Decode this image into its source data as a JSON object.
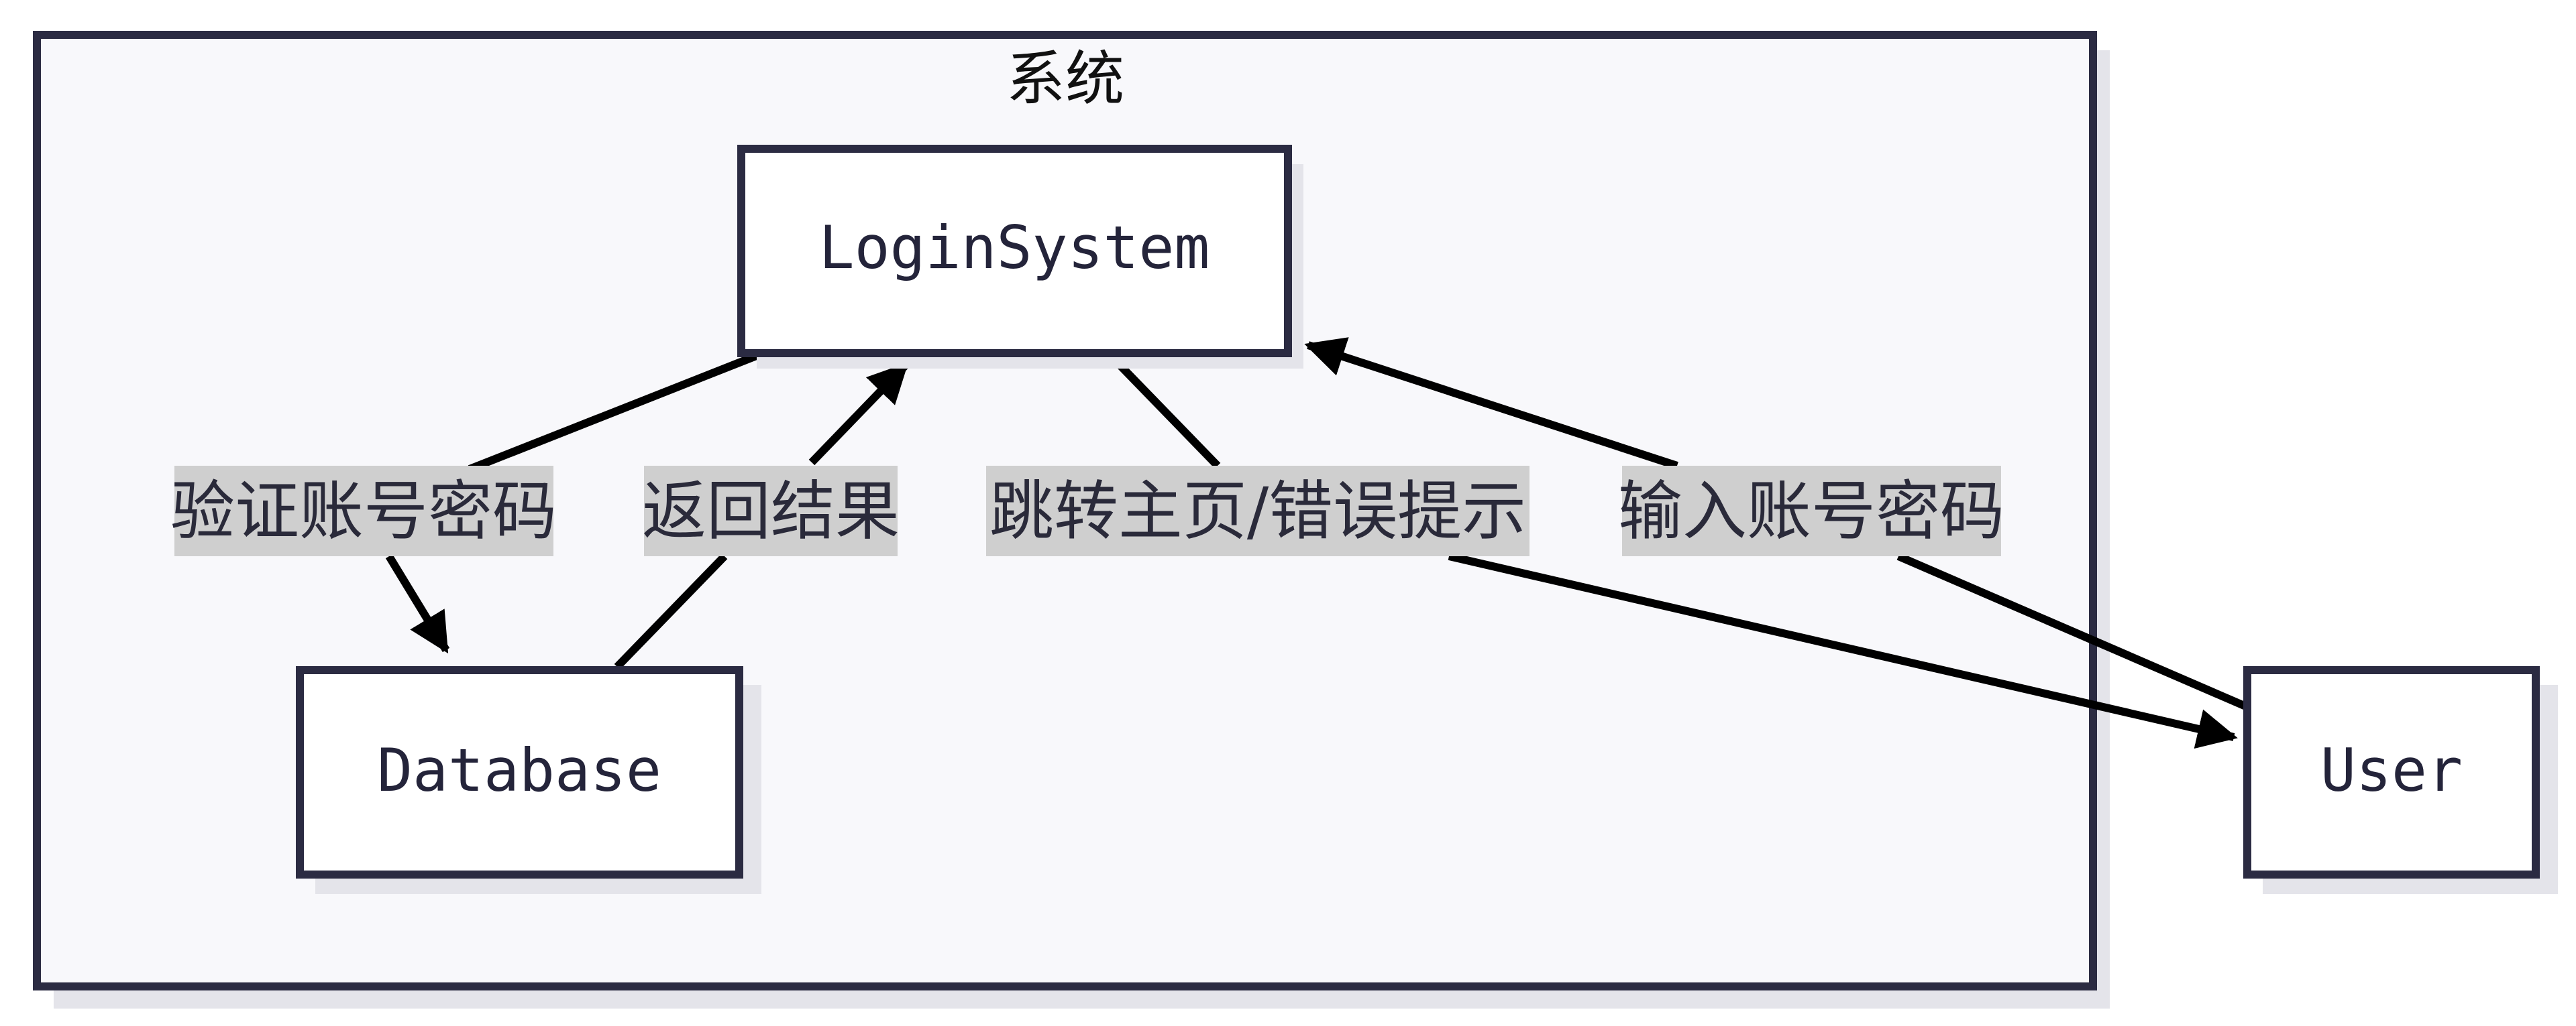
{
  "cluster": {
    "title": "系统"
  },
  "nodes": {
    "login_system": "LoginSystem",
    "database": "Database",
    "user": "User"
  },
  "edges": {
    "verify_credentials": "验证账号密码",
    "return_result": "返回结果",
    "redirect_or_error": "跳转主页/错误提示",
    "input_credentials": "输入账号密码"
  },
  "colors": {
    "cluster_fill": "#f8f8fb",
    "border": "#2b2b42",
    "node_fill": "#ffffff",
    "label_bg": "#cfcfcf",
    "shadow": "#e4e4ea",
    "edge": "#000000"
  }
}
